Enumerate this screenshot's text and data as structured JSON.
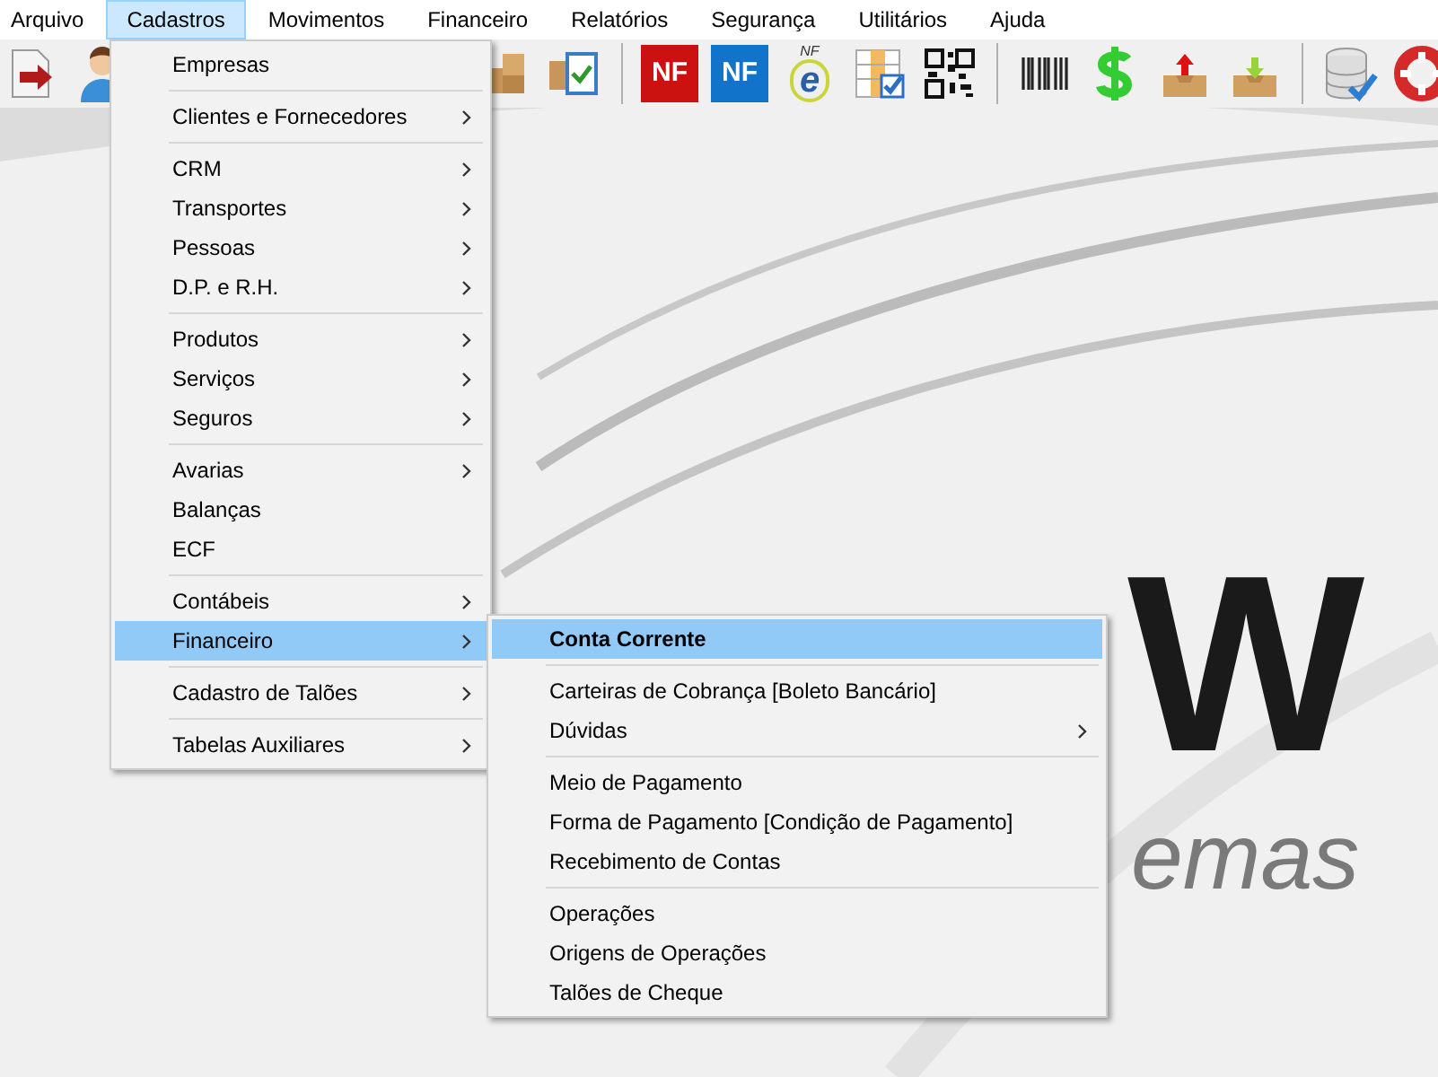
{
  "menubar": [
    {
      "label": "Arquivo",
      "selected": false
    },
    {
      "label": "Cadastros",
      "selected": true
    },
    {
      "label": "Movimentos",
      "selected": false
    },
    {
      "label": "Financeiro",
      "selected": false
    },
    {
      "label": "Relatórios",
      "selected": false
    },
    {
      "label": "Segurança",
      "selected": false
    },
    {
      "label": "Utilitários",
      "selected": false
    },
    {
      "label": "Ajuda",
      "selected": false
    }
  ],
  "toolbar": [
    {
      "kind": "exit"
    },
    {
      "kind": "person"
    },
    {
      "kind": "gap"
    },
    {
      "kind": "boxes"
    },
    {
      "kind": "box-check"
    },
    {
      "kind": "separator"
    },
    {
      "kind": "nf",
      "label": "NF",
      "color": "#cc1111"
    },
    {
      "kind": "nf",
      "label": "NF",
      "color": "#1173c9"
    },
    {
      "kind": "nfe",
      "label": "NF",
      "mark": "e"
    },
    {
      "kind": "sheet"
    },
    {
      "kind": "qr"
    },
    {
      "kind": "separator"
    },
    {
      "kind": "barcode"
    },
    {
      "kind": "dollar"
    },
    {
      "kind": "tray-up"
    },
    {
      "kind": "tray-down"
    },
    {
      "kind": "separator"
    },
    {
      "kind": "database"
    },
    {
      "kind": "lifebuoy"
    }
  ],
  "logo": {
    "letters": "W",
    "tagline": "emas"
  },
  "menu": {
    "groups": [
      [
        {
          "label": "Empresas",
          "submenu": false,
          "selected": false
        }
      ],
      [
        {
          "label": "Clientes e Fornecedores",
          "submenu": true,
          "selected": false
        }
      ],
      [
        {
          "label": "CRM",
          "submenu": true,
          "selected": false
        },
        {
          "label": "Transportes",
          "submenu": true,
          "selected": false
        },
        {
          "label": "Pessoas",
          "submenu": true,
          "selected": false
        },
        {
          "label": "D.P. e R.H.",
          "submenu": true,
          "selected": false
        }
      ],
      [
        {
          "label": "Produtos",
          "submenu": true,
          "selected": false
        },
        {
          "label": "Serviços",
          "submenu": true,
          "selected": false
        },
        {
          "label": "Seguros",
          "submenu": true,
          "selected": false
        }
      ],
      [
        {
          "label": "Avarias",
          "submenu": true,
          "selected": false
        },
        {
          "label": "Balanças",
          "submenu": false,
          "selected": false
        },
        {
          "label": "ECF",
          "submenu": false,
          "selected": false
        }
      ],
      [
        {
          "label": "Contábeis",
          "submenu": true,
          "selected": false
        },
        {
          "label": "Financeiro",
          "submenu": true,
          "selected": true
        }
      ],
      [
        {
          "label": "Cadastro de Talões",
          "submenu": true,
          "selected": false
        }
      ],
      [
        {
          "label": "Tabelas Auxiliares",
          "submenu": true,
          "selected": false
        }
      ]
    ]
  },
  "submenu": {
    "groups": [
      [
        {
          "label": "Conta Corrente",
          "submenu": false,
          "selected": true,
          "bold": true
        }
      ],
      [
        {
          "label": "Carteiras de Cobrança [Boleto Bancário]",
          "submenu": false,
          "selected": false,
          "bold": false
        },
        {
          "label": "Dúvidas",
          "submenu": true,
          "selected": false,
          "bold": false
        }
      ],
      [
        {
          "label": "Meio de Pagamento",
          "submenu": false,
          "selected": false,
          "bold": false
        },
        {
          "label": "Forma de Pagamento [Condição de Pagamento]",
          "submenu": false,
          "selected": false,
          "bold": false
        },
        {
          "label": "Recebimento de Contas",
          "submenu": false,
          "selected": false,
          "bold": false
        }
      ],
      [
        {
          "label": "Operações",
          "submenu": false,
          "selected": false,
          "bold": false
        },
        {
          "label": "Origens de Operações",
          "submenu": false,
          "selected": false,
          "bold": false
        },
        {
          "label": "Talões de Cheque",
          "submenu": false,
          "selected": false,
          "bold": false
        }
      ]
    ]
  }
}
